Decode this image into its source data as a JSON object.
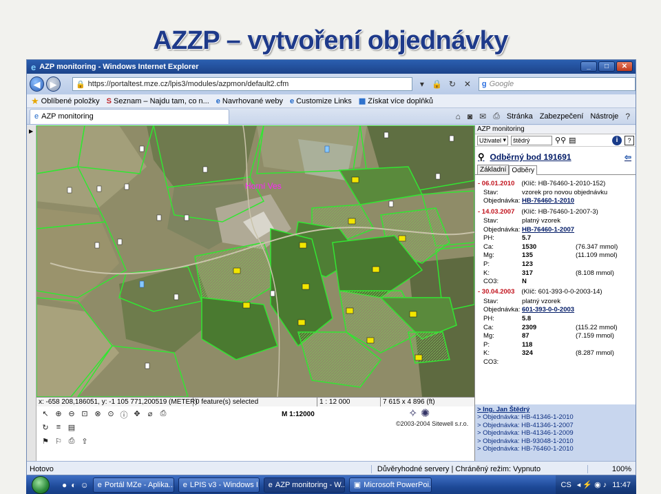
{
  "slide": {
    "title": "AZZP – vytvoření objednávky"
  },
  "browser": {
    "window_title": "AZP monitoring - Windows Internet Explorer",
    "url": "https://portaltest.mze.cz/lpis3/modules/azpmon/default2.cfm",
    "search_placeholder": "Google",
    "tab_title": "AZP monitoring",
    "favorites": [
      {
        "label": "Oblíbené položky"
      },
      {
        "label": "Seznam – Najdu tam, co n..."
      },
      {
        "label": "Navrhované weby"
      },
      {
        "label": "Customize Links"
      },
      {
        "label": "Získat více doplňků"
      }
    ],
    "commands": [
      {
        "label": "Stránka"
      },
      {
        "label": "Zabezpečení"
      },
      {
        "label": "Nástroje"
      }
    ],
    "status": {
      "text": "Hotovo",
      "trusted": "Důvěryhodné servery | Chráněný režim: Vypnuto",
      "zoom": "100%"
    }
  },
  "map": {
    "village_label": "Horní Ves",
    "status_bar": {
      "coords": "x: -658 208,186051, y: -1 105 771,200519 (METER)",
      "features": "0 feature(s) selected",
      "scale": "1 : 12 000",
      "extent": "7 615 x 4 896 (ft)"
    },
    "scale_text": "M 1:12000",
    "copyright": "©2003-2004 Sitewell s.r.o."
  },
  "panel": {
    "header": "AZP monitoring",
    "user_select": "Uživatel",
    "user_value": "štědrý",
    "point_title": "Odběrný bod 191691",
    "tabs": [
      "Základní",
      "Odběry"
    ],
    "samples": [
      {
        "date": "- 06.01.2010",
        "key": "(Klíč: HB-76460-1-2010-152)",
        "rows": [
          {
            "k": "Stav:",
            "v": "vzorek pro novou objednávku",
            "kind": "txt"
          },
          {
            "k": "Objednávka:",
            "v": "HB-76460-1-2010",
            "kind": "link"
          }
        ]
      },
      {
        "date": "- 14.03.2007",
        "key": "(Klíč: HB-76460-1-2007-3)",
        "rows": [
          {
            "k": "Stav:",
            "v": "platný vzorek",
            "kind": "txt"
          },
          {
            "k": "Objednávka:",
            "v": "HB-76460-1-2007",
            "kind": "link"
          },
          {
            "k": "PH:",
            "v": "5.7",
            "m": ""
          },
          {
            "k": "Ca:",
            "v": "1530",
            "m": "(76.347 mmol)"
          },
          {
            "k": "Mg:",
            "v": "135",
            "m": "(11.109 mmol)"
          },
          {
            "k": "P:",
            "v": "123",
            "m": ""
          },
          {
            "k": "K:",
            "v": "317",
            "m": "(8.108 mmol)"
          },
          {
            "k": "CO3:",
            "v": "N",
            "m": ""
          }
        ]
      },
      {
        "date": "- 30.04.2003",
        "key": "(Klíč: 601-393-0-0-2003-14)",
        "rows": [
          {
            "k": "Stav:",
            "v": "platný vzorek",
            "kind": "txt"
          },
          {
            "k": "Objednávka:",
            "v": "601-393-0-0-2003",
            "kind": "link"
          },
          {
            "k": "PH:",
            "v": "5.8",
            "m": ""
          },
          {
            "k": "Ca:",
            "v": "2309",
            "m": "(115.22 mmol)"
          },
          {
            "k": "Mg:",
            "v": "87",
            "m": "(7.159 mmol)"
          },
          {
            "k": "P:",
            "v": "118",
            "m": ""
          },
          {
            "k": "K:",
            "v": "324",
            "m": "(8.287 mmol)"
          },
          {
            "k": "CO3:",
            "v": "",
            "m": ""
          }
        ]
      }
    ],
    "owner": "> Ing. Jan Štědrý",
    "orders": [
      "> Objednávka: HB-41346-1-2010",
      "> Objednávka: HB-41346-1-2007",
      "> Objednávka: HB-41346-1-2009",
      "> Objednávka: HB-93048-1-2010",
      "> Objednávka: HB-76460-1-2010"
    ]
  },
  "taskbar": {
    "items": [
      {
        "label": "Portál MZe - Aplika...",
        "active": false
      },
      {
        "label": "LPIS v3 - Windows I...",
        "active": false
      },
      {
        "label": "AZP monitoring - W...",
        "active": true
      },
      {
        "label": "Microsoft PowerPoi...",
        "active": false
      }
    ],
    "lang": "CS",
    "clock": "11:47"
  },
  "colors": {
    "parcel_border": "#32e632",
    "order_field": "#4a8a3a",
    "flag": "#f2e600"
  }
}
